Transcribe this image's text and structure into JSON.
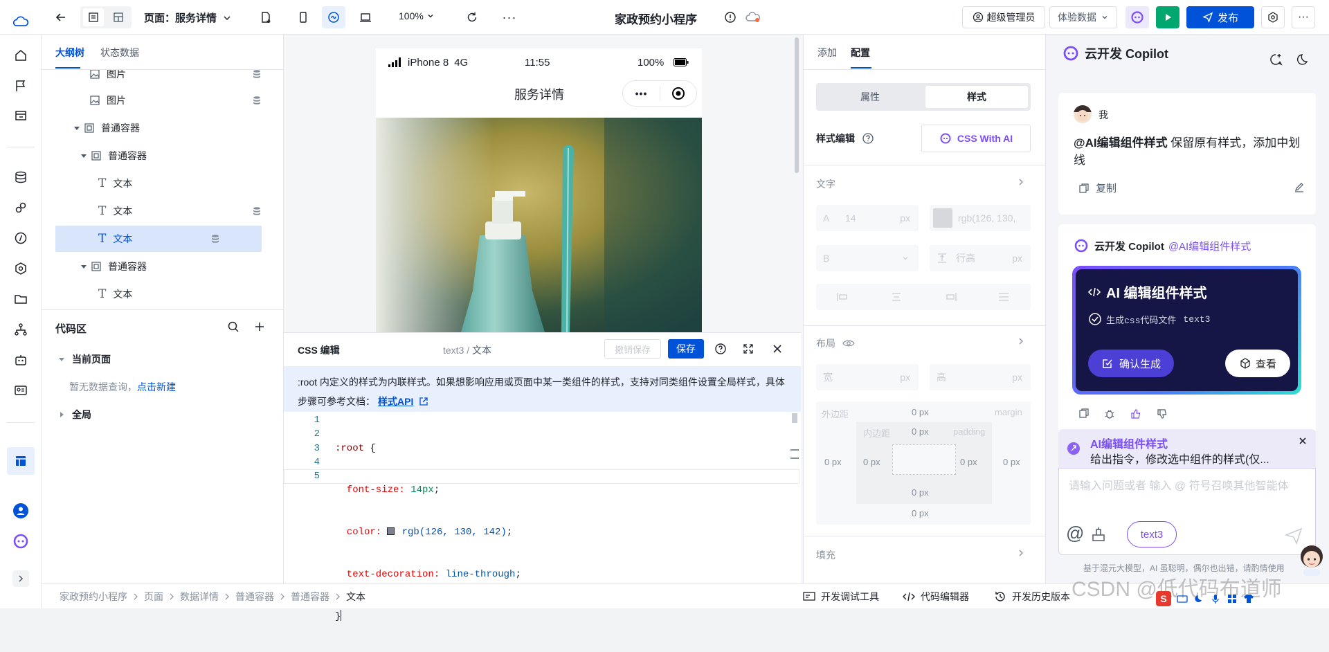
{
  "topbar": {
    "page_label": "页面：服务详情",
    "zoom": "100%",
    "app_title": "家政预约小程序",
    "role": "超级管理员",
    "data_mode": "体验数据",
    "publish": "发布"
  },
  "outline": {
    "tab_tree": "大纲树",
    "tab_state": "状态数据",
    "rows": [
      {
        "label": "图片"
      },
      {
        "label": "图片"
      },
      {
        "label": "普通容器"
      },
      {
        "label": "普通容器"
      },
      {
        "label": "文本"
      },
      {
        "label": "文本"
      },
      {
        "label": "文本"
      },
      {
        "label": "普通容器"
      },
      {
        "label": "文本"
      }
    ],
    "code_title": "代码区",
    "current_page": "当前页面",
    "no_query": "暂无数据查询，",
    "create_new": "点击新建",
    "global": "全局"
  },
  "phone": {
    "carrier": "iPhone 8",
    "network": "4G",
    "time": "11:55",
    "battery": "100%",
    "title": "服务详情",
    "menu_dots": "•••"
  },
  "css_editor": {
    "title": "CSS 编辑",
    "crumb_a": "text3",
    "crumb_sep": "/",
    "crumb_b": "文本",
    "undo_save": "撤销保存",
    "save": "保存",
    "notice": ":root 内定义的样式为内联样式。如果想影响应用或页面中某一类组件的样式，支持对同类组件设置全局样式，具体步骤可参考文档：",
    "doc_link": "样式API",
    "lines": [
      {
        "n": "1",
        "a": ":root",
        "b": " {"
      },
      {
        "n": "2",
        "a": "  font-size:",
        "b": " 14px",
        "c": ";"
      },
      {
        "n": "3",
        "a": "  color:",
        "b": " rgb(126, 130, 142)",
        "c": ";"
      },
      {
        "n": "4",
        "a": "  text-decoration:",
        "b": " line-through",
        "c": ";"
      },
      {
        "n": "5",
        "a": "}",
        "b": ""
      }
    ],
    "swatch_color": "#7e828e"
  },
  "props": {
    "tab_add": "添加",
    "tab_config": "配置",
    "seg_attr": "属性",
    "seg_style": "样式",
    "style_edit": "样式编辑",
    "css_ai": "CSS With AI",
    "text_section": "文字",
    "font_size_prefix": "A",
    "font_size": "14",
    "unit_px": "px",
    "color_value": "rgb(126, 130,",
    "bold_prefix": "B",
    "line_height": "行高",
    "layout_section": "布局",
    "width": "宽",
    "height": "高",
    "margin_outer": "外边距",
    "margin_label": "margin",
    "inner_margin": "内边距",
    "padding_label": "padding",
    "zero_px": "0 px",
    "fill_section": "填充"
  },
  "copilot": {
    "title": "云开发 Copilot",
    "me": "我",
    "user_msg_at": "@AI编辑组件样式",
    "user_msg": " 保留原有样式，添加中划线",
    "copy": "复制",
    "bot_name": "云开发 Copilot",
    "bot_at": "@AI编辑组件样式",
    "card_title": "AI 编辑组件样式",
    "card_item": "生成css代码文件",
    "card_item_code": "text3",
    "confirm": "确认生成",
    "view": "查看",
    "skill_title": "AI编辑组件样式",
    "skill_desc": "给出指令，修改选中组件的样式(仅...",
    "input_placeholder": "请输入问题或者 输入 @ 符号召唤其他智能体",
    "chip": "text3",
    "footer": "基于混元大模型，AI 虽聪明，偶尔也出错，请酌情使用"
  },
  "bottombar": {
    "crumbs": [
      "家政预约小程序",
      "页面",
      "数据详情",
      "普通容器",
      "普通容器",
      "文本"
    ],
    "dev_tools": "开发调试工具",
    "code_editor": "代码编辑器",
    "history": "开发历史版本"
  },
  "watermark": "CSDN @低代码布道师",
  "colors": {
    "primary": "#0052d9",
    "selected_row": "#d9e5fb",
    "notice_bg": "#e8f0fd",
    "ai_purple": "#7b4ef9",
    "green": "#00a870"
  }
}
